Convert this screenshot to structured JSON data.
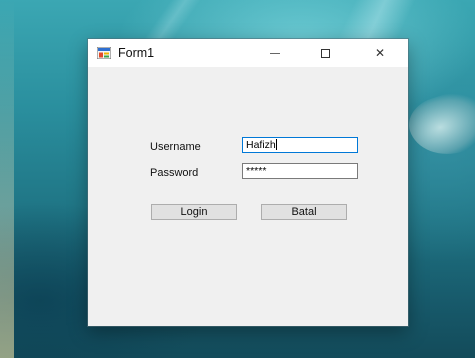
{
  "window": {
    "title": "Form1",
    "icon": "winforms-app-icon",
    "controls": {
      "minimize_icon": "minimize-icon",
      "maximize_icon": "maximize-icon",
      "close_icon": "close-icon",
      "close_glyph": "✕"
    }
  },
  "form": {
    "username_label": "Username",
    "username_value": "Hafizh",
    "password_label": "Password",
    "password_value": "*****",
    "login_label": "Login",
    "batal_label": "Batal"
  },
  "desktop": {
    "wallpaper": "underwater ocean"
  }
}
